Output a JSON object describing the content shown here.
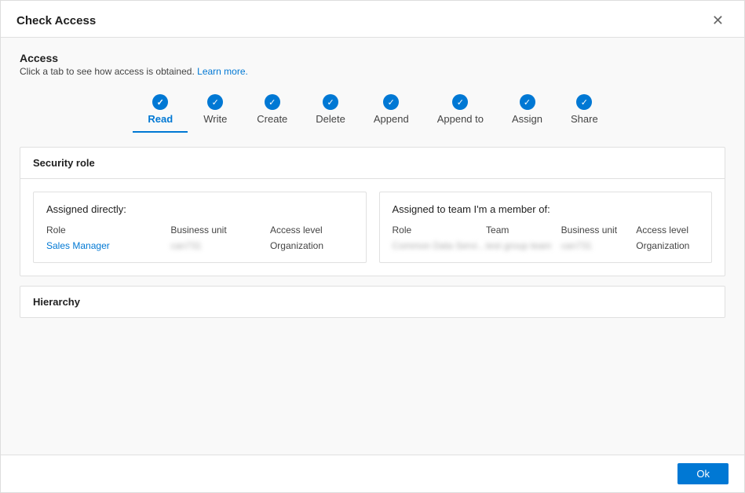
{
  "dialog": {
    "title": "Check Access",
    "close_label": "✕"
  },
  "access": {
    "title": "Access",
    "subtitle": "Click a tab to see how access is obtained.",
    "learn_more": "Learn more."
  },
  "tabs": [
    {
      "id": "read",
      "label": "Read",
      "active": true
    },
    {
      "id": "write",
      "label": "Write",
      "active": false
    },
    {
      "id": "create",
      "label": "Create",
      "active": false
    },
    {
      "id": "delete",
      "label": "Delete",
      "active": false
    },
    {
      "id": "append",
      "label": "Append",
      "active": false
    },
    {
      "id": "append-to",
      "label": "Append to",
      "active": false
    },
    {
      "id": "assign",
      "label": "Assign",
      "active": false
    },
    {
      "id": "share",
      "label": "Share",
      "active": false
    }
  ],
  "security_role": {
    "title": "Security role",
    "assigned_directly": {
      "heading": "Assigned directly:",
      "col_role": "Role",
      "col_bu": "Business unit",
      "col_access": "Access level",
      "role_link_prefix": "Sales",
      "role_link_text": "Manager",
      "bu_value": "can731",
      "access_value": "Organization"
    },
    "assigned_team": {
      "heading": "Assigned to team I'm a member of:",
      "col_role": "Role",
      "col_team": "Team",
      "col_bu": "Business unit",
      "col_access": "Access level",
      "role_value": "Common Data Servi...",
      "team_value": "test group team",
      "bu_value": "can731",
      "access_value": "Organization"
    }
  },
  "hierarchy": {
    "title": "Hierarchy"
  },
  "footer": {
    "ok_label": "Ok"
  }
}
